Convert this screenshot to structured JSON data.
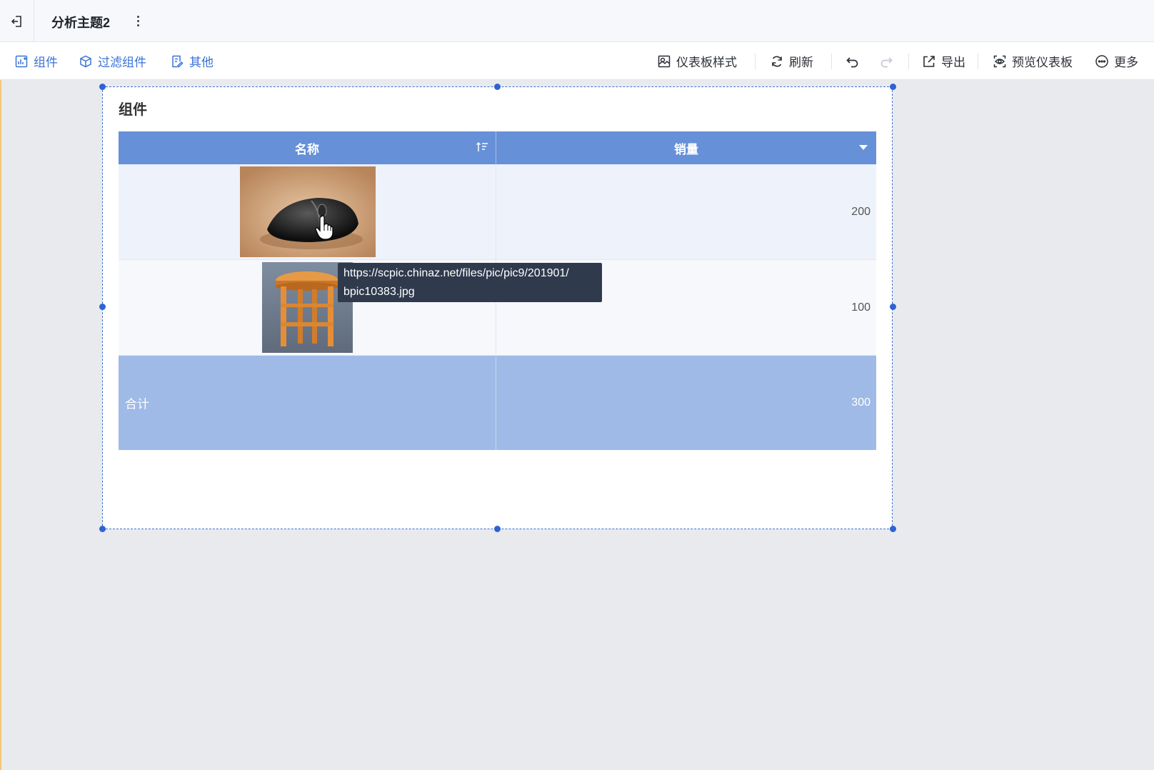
{
  "header": {
    "title": "分析主题2"
  },
  "toolbar": {
    "left": [
      {
        "label": "组件",
        "icon": "component-add-icon"
      },
      {
        "label": "过滤组件",
        "icon": "filter-component-icon"
      },
      {
        "label": "其他",
        "icon": "other-doc-icon"
      }
    ],
    "right": {
      "dashboard_style": "仪表板样式",
      "refresh": "刷新",
      "export": "导出",
      "preview": "预览仪表板",
      "more": "更多"
    }
  },
  "widget": {
    "title": "组件",
    "table": {
      "columns": [
        "名称",
        "销量"
      ],
      "rows": [
        {
          "image": "mouse-image",
          "sales": "200"
        },
        {
          "image": "stool-image",
          "sales": "100"
        }
      ],
      "total": {
        "label": "合计",
        "sales": "300"
      }
    }
  },
  "tooltip": {
    "line1": "https://scpic.chinaz.net/files/pic/pic9/201901/",
    "line2": "bpic10383.jpg"
  },
  "colors": {
    "accent": "#3b72d6",
    "header_bg": "#6690d8",
    "total_bg": "#9fbae6",
    "selection": "#2f62d2"
  }
}
